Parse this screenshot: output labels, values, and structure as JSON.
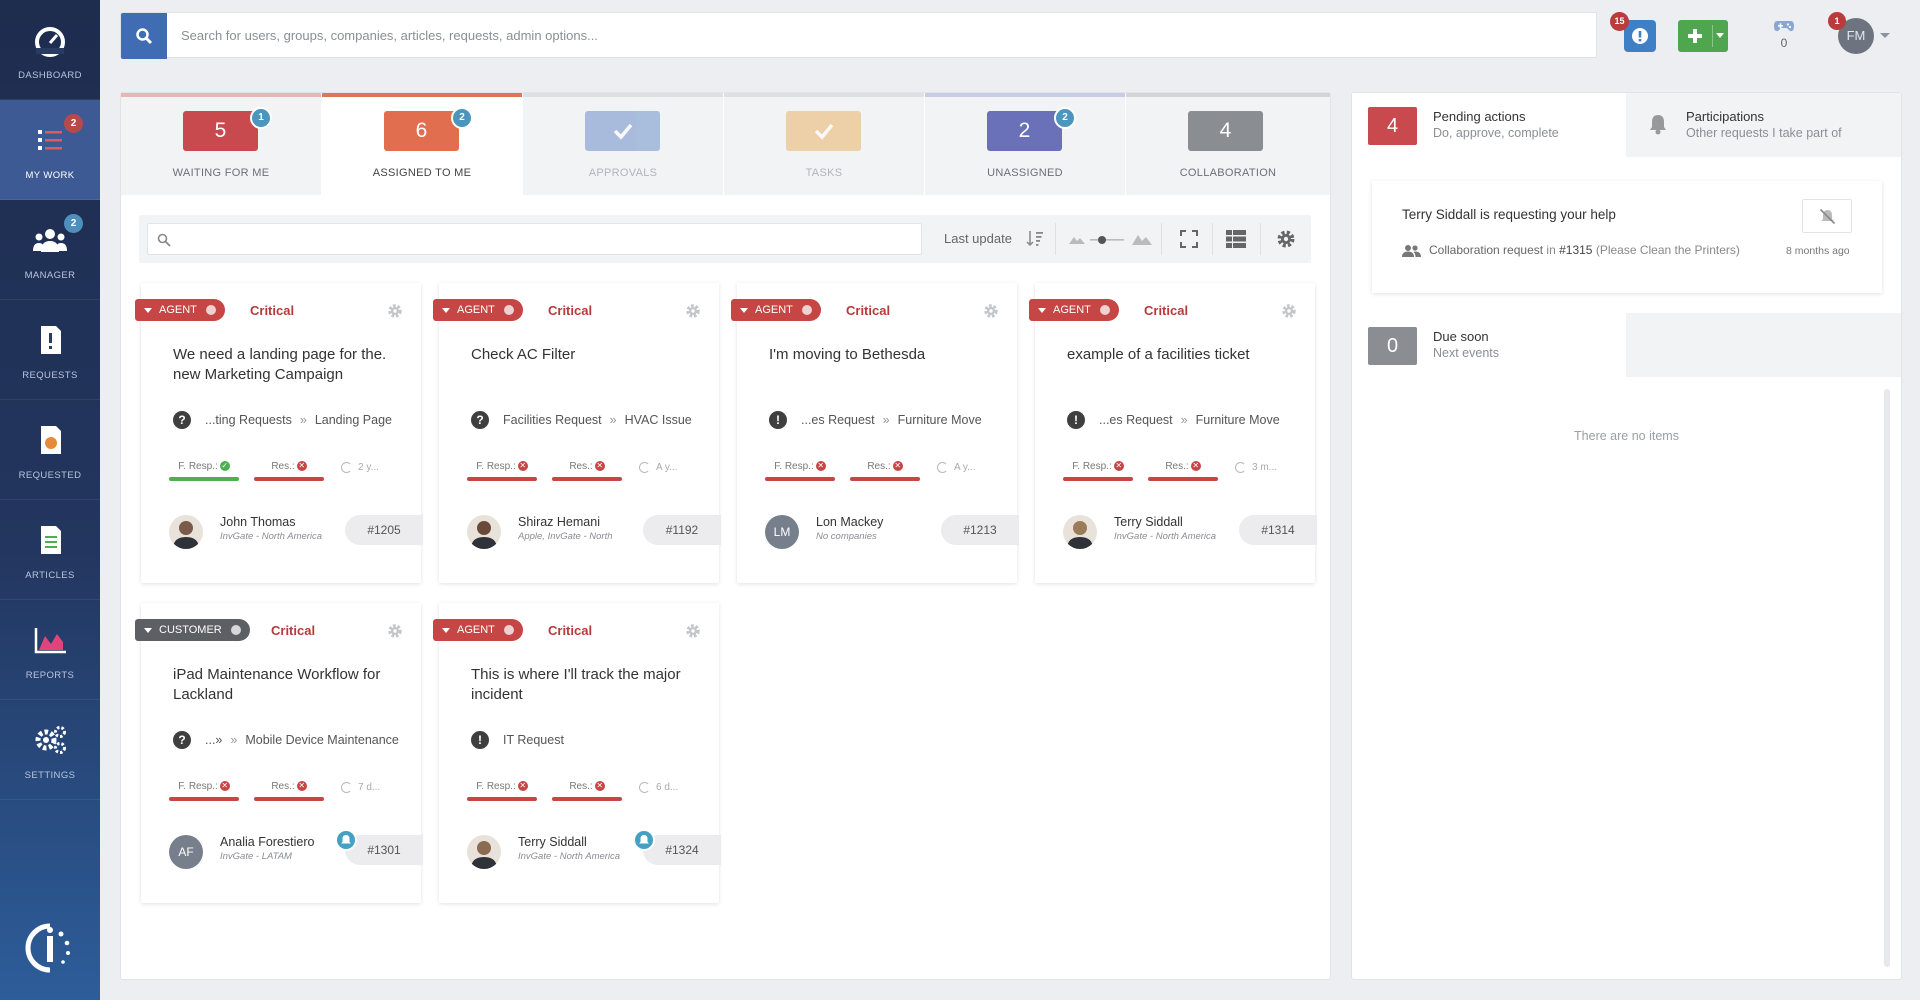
{
  "sidebar": {
    "items": [
      {
        "label": "DASHBOARD",
        "badge": ""
      },
      {
        "label": "MY WORK",
        "badge": "2"
      },
      {
        "label": "MANAGER",
        "badge": "2"
      },
      {
        "label": "REQUESTS",
        "badge": ""
      },
      {
        "label": "REQUESTED",
        "badge": ""
      },
      {
        "label": "ARTICLES",
        "badge": ""
      },
      {
        "label": "REPORTS",
        "badge": ""
      },
      {
        "label": "SETTINGS",
        "badge": ""
      }
    ]
  },
  "topbar": {
    "search_placeholder": "Search for users, groups, companies, articles, requests, admin options...",
    "notifications_count": "15",
    "game_count": "0",
    "user_initials": "FM",
    "user_badge": "1"
  },
  "tabs": [
    {
      "count": "5",
      "badge": "1",
      "label": "WAITING FOR ME",
      "color": "#c84a4e"
    },
    {
      "count": "6",
      "badge": "2",
      "label": "ASSIGNED TO ME",
      "color": "#e06e4f"
    },
    {
      "count": "",
      "badge": "",
      "label": "APPROVALS",
      "color": "#6d8fc9"
    },
    {
      "count": "",
      "badge": "",
      "label": "TASKS",
      "color": "#eab36a"
    },
    {
      "count": "2",
      "badge": "2",
      "label": "UNASSIGNED",
      "color": "#6a71b8"
    },
    {
      "count": "4",
      "badge": "",
      "label": "COLLABORATION",
      "color": "#8a8d91"
    }
  ],
  "toolbar": {
    "filter_value": "",
    "sort_label": "Last update"
  },
  "cards": [
    {
      "role": "AGENT",
      "priority": "Critical",
      "title": "We need a landing page for the. new Marketing Campaign",
      "cat_icon": "?",
      "cat1": "...ting Requests",
      "cat2": "Landing Page",
      "f_resp": "F. Resp.:",
      "res": "Res.:",
      "time": "2 y...",
      "person": "John Thomas",
      "company": "InvGate - North America",
      "initials": "",
      "id": "#1205"
    },
    {
      "role": "AGENT",
      "priority": "Critical",
      "title": "Check AC Filter",
      "cat_icon": "?",
      "cat1": "Facilities Request",
      "cat2": "HVAC Issue",
      "f_resp": "F. Resp.:",
      "res": "Res.:",
      "time": "A y...",
      "person": "Shiraz Hemani",
      "company": "Apple, InvGate - North",
      "initials": "",
      "id": "#1192"
    },
    {
      "role": "AGENT",
      "priority": "Critical",
      "title": "I'm moving to Bethesda",
      "cat_icon": "!",
      "cat1": "...es Request",
      "cat2": "Furniture Move",
      "f_resp": "F. Resp.:",
      "res": "Res.:",
      "time": "A y...",
      "person": "Lon Mackey",
      "company": "No companies",
      "initials": "LM",
      "id": "#1213"
    },
    {
      "role": "AGENT",
      "priority": "Critical",
      "title": "example of a facilities ticket",
      "cat_icon": "!",
      "cat1": "...es Request",
      "cat2": "Furniture Move",
      "f_resp": "F. Resp.:",
      "res": "Res.:",
      "time": "3 m...",
      "person": "Terry Siddall",
      "company": "InvGate - North America",
      "initials": "",
      "id": "#1314"
    },
    {
      "role": "CUSTOMER",
      "priority": "Critical",
      "title": "iPad Maintenance Workflow for Lackland",
      "cat_icon": "?",
      "cat1": "...»",
      "cat2": "Mobile Device Maintenance",
      "f_resp": "F. Resp.:",
      "res": "Res.:",
      "time": "7 d...",
      "person": "Analia Forestiero",
      "company": "InvGate - LATAM",
      "initials": "AF",
      "id": "#1301"
    },
    {
      "role": "AGENT",
      "priority": "Critical",
      "title": "This is where I'll track the major incident",
      "cat_icon": "!",
      "cat1": "IT Request",
      "cat2": "",
      "f_resp": "F. Resp.:",
      "res": "Res.:",
      "time": "6 d...",
      "person": "Terry Siddall",
      "company": "InvGate - North America",
      "initials": "",
      "id": "#1324"
    }
  ],
  "right_panel": {
    "pending": {
      "count": "4",
      "title": "Pending actions",
      "subtitle": "Do, approve, complete"
    },
    "participations": {
      "title": "Participations",
      "subtitle": "Other requests I take part of"
    },
    "help": {
      "title": "Terry Siddall is requesting your help",
      "type": "Collaboration request",
      "in": "in",
      "ticket": "#1315",
      "detail": "(Please Clean the Printers)",
      "time": "8 months ago"
    },
    "due": {
      "count": "0",
      "title": "Due soon",
      "subtitle": "Next events"
    },
    "empty_text": "There are no items"
  },
  "colors": {
    "agent": "#c64545",
    "customer": "#5c5f64",
    "critical": "#b73a3a",
    "sla_ok": "#4caf50",
    "sla_bad": "#c64545",
    "accent": "#3f6cb3"
  }
}
